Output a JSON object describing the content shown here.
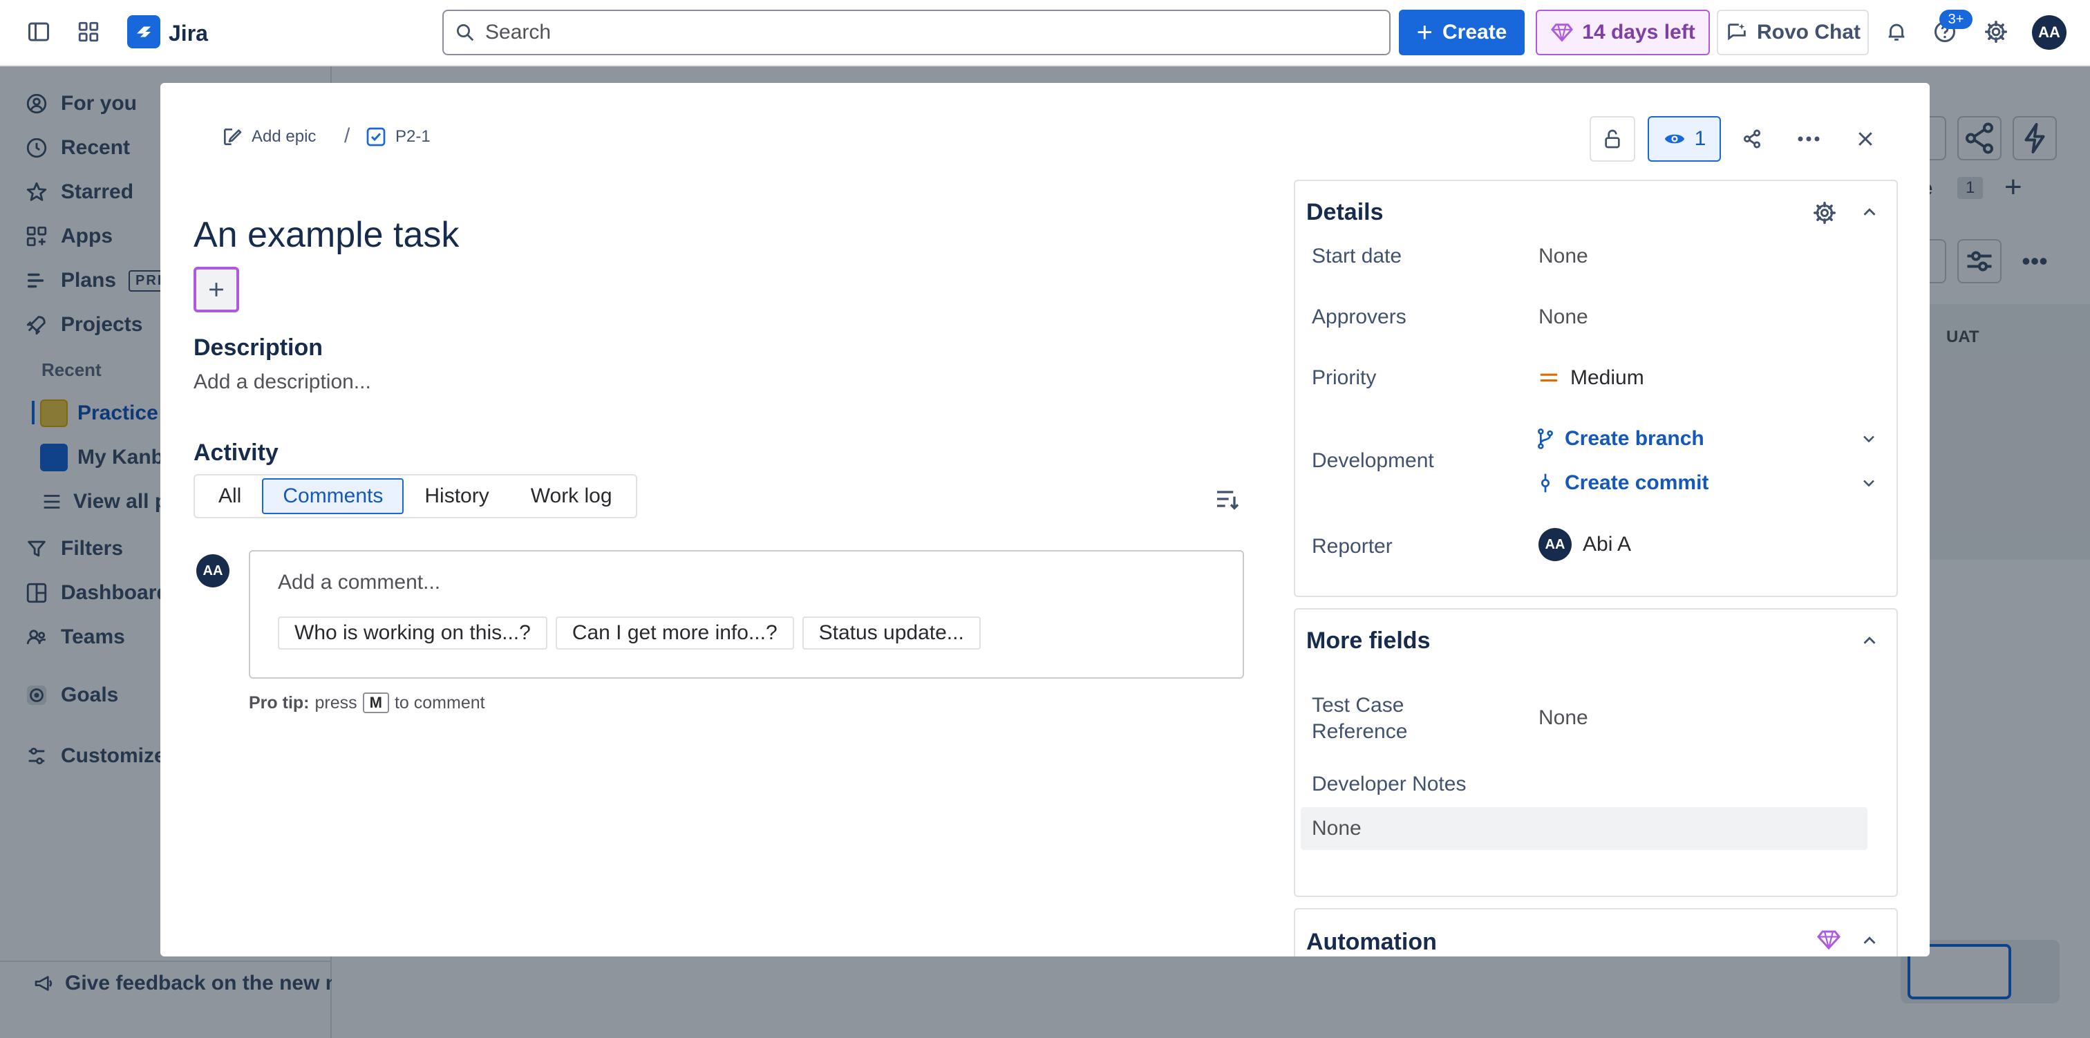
{
  "topnav": {
    "app_name": "Jira",
    "search_placeholder": "Search",
    "create_label": "Create",
    "trial_label": "14 days left",
    "rovo_label": "Rovo Chat",
    "notification_badge": "3+",
    "user_initials": "AA"
  },
  "sidebar": {
    "items": [
      {
        "label": "For you"
      },
      {
        "label": "Recent"
      },
      {
        "label": "Starred"
      },
      {
        "label": "Apps"
      },
      {
        "label": "Plans"
      },
      {
        "label": "Projects"
      }
    ],
    "plans_badge": "PREMIUM",
    "recent_heading": "Recent",
    "projects": [
      {
        "label": "Practice Scrum project"
      },
      {
        "label": "My Kanban project"
      },
      {
        "label": "View all projects"
      }
    ],
    "items2": [
      {
        "label": "Filters"
      },
      {
        "label": "Dashboards"
      },
      {
        "label": "Teams"
      },
      {
        "label": "Goals"
      },
      {
        "label": "Customize sidebar"
      }
    ],
    "feedback_label": "Give feedback on the new navigation"
  },
  "board": {
    "column_label": "UAT",
    "more_count": "1",
    "more_label": "re"
  },
  "modal": {
    "breadcrumb": {
      "add_epic": "Add epic",
      "separator": "/",
      "issue_key": "P2-1"
    },
    "title": "An example task",
    "description_heading": "Description",
    "description_placeholder": "Add a description...",
    "activity_heading": "Activity",
    "activity_tabs": [
      "All",
      "Comments",
      "History",
      "Work log"
    ],
    "active_tab": "Comments",
    "comment": {
      "avatar": "AA",
      "placeholder": "Add a comment...",
      "suggestions": [
        "Who is working on this...?",
        "Can I get more info...?",
        "Status update..."
      ]
    },
    "protip": {
      "label": "Pro tip:",
      "press": "press",
      "key": "M",
      "suffix": "to comment"
    },
    "watch_count": "1",
    "details": {
      "heading": "Details",
      "start_date_label": "Start date",
      "start_date_value": "None",
      "approvers_label": "Approvers",
      "approvers_value": "None",
      "priority_label": "Priority",
      "priority_value": "Medium",
      "development_label": "Development",
      "create_branch": "Create branch",
      "create_commit": "Create commit",
      "reporter_label": "Reporter",
      "reporter_initials": "AA",
      "reporter_name": "Abi A"
    },
    "more_fields": {
      "heading": "More fields",
      "test_case_label": "Test Case Reference",
      "test_case_value": "None",
      "dev_notes_label": "Developer Notes",
      "dev_notes_value": "None"
    },
    "automation": {
      "heading": "Automation"
    }
  },
  "colors": {
    "primary": "#1868db",
    "purple": "#af59e1",
    "priority_medium": "#e06c00"
  }
}
